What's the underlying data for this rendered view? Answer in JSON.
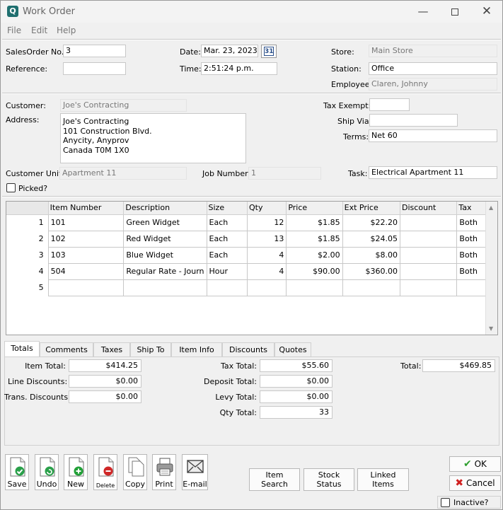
{
  "window": {
    "title": "Work Order",
    "app_icon": "Q"
  },
  "menu": [
    "File",
    "Edit",
    "Help"
  ],
  "header": {
    "salesorder_label": "SalesOrder No.:",
    "salesorder_value": "3",
    "reference_label": "Reference:",
    "reference_value": "",
    "date_label": "Date:",
    "date_value": "Mar. 23, 2023",
    "calendar_day": "31",
    "time_label": "Time:",
    "time_value": "2:51:24 p.m.",
    "store_label": "Store:",
    "store_value": "Main Store",
    "station_label": "Station:",
    "station_value": "Office",
    "employee_label": "Employee:",
    "employee_value": "Claren, Johnny"
  },
  "customer": {
    "customer_label": "Customer:",
    "customer_value": "Joe's Contracting",
    "address_label": "Address:",
    "address_lines": [
      "Joe's Contracting",
      "101 Construction Blvd.",
      "Anycity, Anyprov",
      "Canada  T0M 1X0"
    ],
    "tax_exempt_label": "Tax Exempt:",
    "tax_exempt_value": "",
    "ship_via_label": "Ship Via:",
    "ship_via_value": "",
    "terms_label": "Terms:",
    "terms_value": "Net 60",
    "unit_label": "Customer Unit:",
    "unit_value": "Apartment 11",
    "job_label": "Job Number:",
    "job_value": "1",
    "task_label": "Task:",
    "task_value": "Electrical Apartment 11",
    "picked_label": "Picked?"
  },
  "grid": {
    "columns": [
      "Item Number",
      "Description",
      "Size",
      "Qty",
      "Price",
      "Ext Price",
      "Discount",
      "Tax"
    ],
    "rows": [
      {
        "n": "1",
        "item": "101",
        "desc": "Green Widget",
        "size": "Each",
        "qty": "12",
        "price": "$1.85",
        "ext": "$22.20",
        "disc": "",
        "tax": "Both"
      },
      {
        "n": "2",
        "item": "102",
        "desc": "Red Widget",
        "size": "Each",
        "qty": "13",
        "price": "$1.85",
        "ext": "$24.05",
        "disc": "",
        "tax": "Both"
      },
      {
        "n": "3",
        "item": "103",
        "desc": "Blue Widget",
        "size": "Each",
        "qty": "4",
        "price": "$2.00",
        "ext": "$8.00",
        "disc": "",
        "tax": "Both"
      },
      {
        "n": "4",
        "item": "504",
        "desc": "Regular Rate - Journ",
        "size": "Hour",
        "qty": "4",
        "price": "$90.00",
        "ext": "$360.00",
        "disc": "",
        "tax": "Both"
      },
      {
        "n": "5",
        "item": "",
        "desc": "",
        "size": "",
        "qty": "",
        "price": "",
        "ext": "",
        "disc": "",
        "tax": ""
      }
    ]
  },
  "tabs": [
    "Totals",
    "Comments",
    "Taxes",
    "Ship To",
    "Item Info",
    "Discounts",
    "Quotes"
  ],
  "totals": {
    "item_total_label": "Item Total:",
    "item_total": "$414.25",
    "line_disc_label": "Line Discounts:",
    "line_disc": "$0.00",
    "trans_disc_label": "Trans. Discounts:",
    "trans_disc": "$0.00",
    "tax_total_label": "Tax Total:",
    "tax_total": "$55.60",
    "deposit_label": "Deposit Total:",
    "deposit": "$0.00",
    "levy_label": "Levy Total:",
    "levy": "$0.00",
    "qty_label": "Qty Total:",
    "qty": "33",
    "total_label": "Total:",
    "total": "$469.85"
  },
  "toolbar": {
    "save": "Save",
    "undo": "Undo",
    "new": "New",
    "delete": "Delete",
    "copy": "Copy",
    "print": "Print",
    "email": "E-mail"
  },
  "bottom": {
    "item_search": [
      "Item",
      "Search"
    ],
    "stock_status": [
      "Stock",
      "Status"
    ],
    "linked_items": [
      "Linked",
      "Items"
    ],
    "ok": "OK",
    "cancel": "Cancel",
    "inactive": "Inactive?"
  },
  "colors": {
    "ok_check": "#2e9e2e",
    "cancel_x": "#d02020",
    "save_green": "#2aa04a",
    "new_green": "#22a038",
    "delete_red": "#d02828"
  }
}
